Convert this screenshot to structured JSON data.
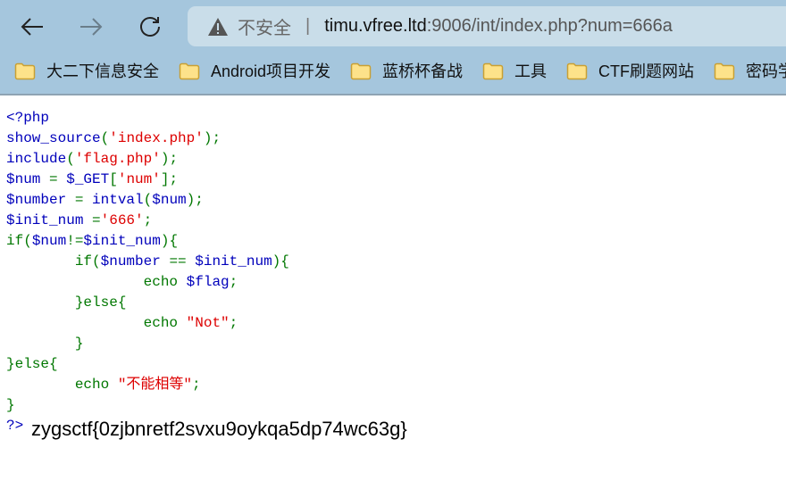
{
  "browser": {
    "security_label": "不安全",
    "url_host": "timu.vfree.ltd",
    "url_rest": ":9006/int/index.php?num=666a",
    "bookmarks": [
      "大二下信息安全",
      "Android项目开发",
      "蓝桥杯备战",
      "工具",
      "CTF刷题网站",
      "密码学"
    ]
  },
  "colors": {
    "default": "#0000BB",
    "keyword": "#007700",
    "string": "#DD0000"
  },
  "code_lines": [
    [
      [
        "def",
        "<?php"
      ]
    ],
    [
      [
        "def",
        "show_source"
      ],
      [
        "kw",
        "("
      ],
      [
        "str",
        "'index.php'"
      ],
      [
        "kw",
        ");"
      ]
    ],
    [
      [
        "def",
        "include"
      ],
      [
        "kw",
        "("
      ],
      [
        "str",
        "'flag.php'"
      ],
      [
        "kw",
        ");"
      ]
    ],
    [
      [
        "def",
        "$num "
      ],
      [
        "kw",
        "= "
      ],
      [
        "def",
        "$_GET"
      ],
      [
        "kw",
        "["
      ],
      [
        "str",
        "'num'"
      ],
      [
        "kw",
        "];"
      ]
    ],
    [
      [
        "def",
        "$number "
      ],
      [
        "kw",
        "= "
      ],
      [
        "def",
        "intval"
      ],
      [
        "kw",
        "("
      ],
      [
        "def",
        "$num"
      ],
      [
        "kw",
        ");"
      ]
    ],
    [
      [
        "def",
        "$init_num "
      ],
      [
        "kw",
        "="
      ],
      [
        "str",
        "'666'"
      ],
      [
        "kw",
        ";"
      ]
    ],
    [
      [
        "kw",
        "if("
      ],
      [
        "def",
        "$num"
      ],
      [
        "kw",
        "!="
      ],
      [
        "def",
        "$init_num"
      ],
      [
        "kw",
        "){"
      ]
    ],
    [
      [
        "kw",
        "\tif("
      ],
      [
        "def",
        "$number "
      ],
      [
        "kw",
        "== "
      ],
      [
        "def",
        "$init_num"
      ],
      [
        "kw",
        "){"
      ]
    ],
    [
      [
        "kw",
        "\t\techo "
      ],
      [
        "def",
        "$flag"
      ],
      [
        "kw",
        ";"
      ]
    ],
    [
      [
        "kw",
        "\t}else{"
      ]
    ],
    [
      [
        "kw",
        "\t\techo "
      ],
      [
        "str",
        "\"Not\""
      ],
      [
        "kw",
        ";"
      ]
    ],
    [
      [
        "kw",
        "\t}"
      ]
    ],
    [
      [
        "kw",
        "}else{"
      ]
    ],
    [
      [
        "kw",
        "\techo "
      ],
      [
        "str",
        "\"不能相等\""
      ],
      [
        "kw",
        ";"
      ]
    ],
    [
      [
        "kw",
        "}"
      ]
    ],
    [
      [
        "def",
        "?>"
      ]
    ]
  ],
  "output": "zygsctf{0zjbnretf2svxu9oykqa5dp74wc63g}"
}
